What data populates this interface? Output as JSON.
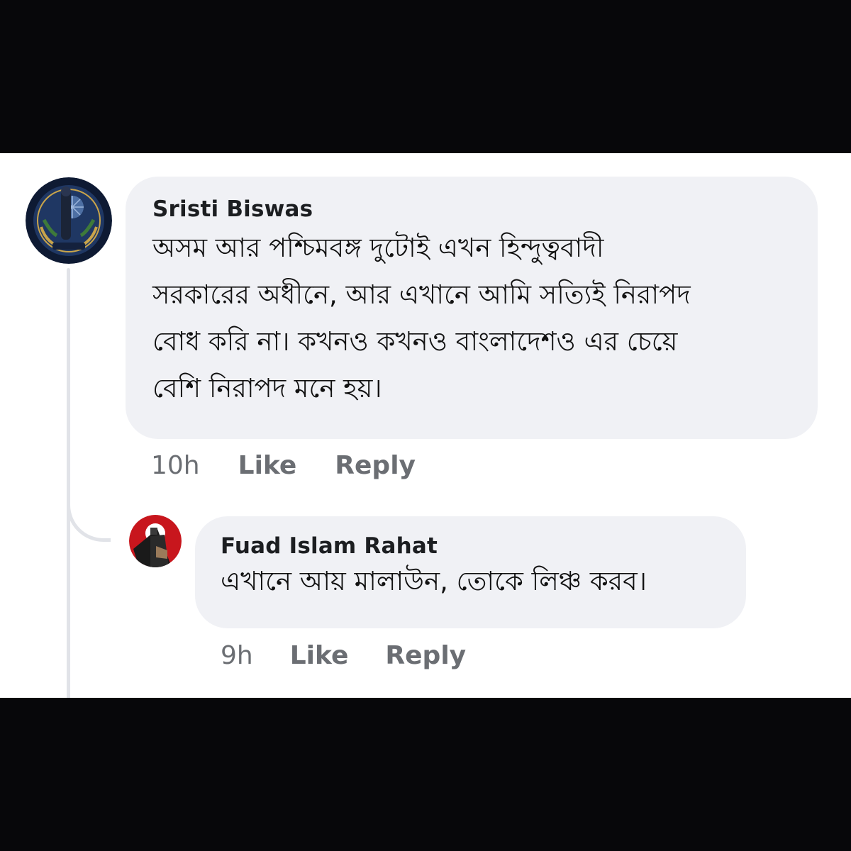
{
  "comments": [
    {
      "author": "Sristi Biswas",
      "text": "অসম আর পশ্চিমবঙ্গ দুটোই এখন হিন্দুত্ববাদী\nসরকারের অধীনে, আর এখানে আমি সত্যিই নিরাপদ\nবোধ করি না। কখনও কখনও বাংলাদেশও এর চেয়ে\nবেশি নিরাপদ মনে হয়।",
      "time": "10h",
      "like_label": "Like",
      "reply_label": "Reply",
      "avatar_icon": "emblem-avatar-icon"
    },
    {
      "author": "Fuad Islam Rahat",
      "text": "এখানে আয় মালাউন, তোকে লিঞ্চ করব।",
      "time": "9h",
      "like_label": "Like",
      "reply_label": "Reply",
      "avatar_icon": "red-figure-avatar-icon"
    }
  ],
  "colors": {
    "bubble_bg": "#f0f1f5",
    "meta_text": "#6b6e73",
    "thread_line": "#e1e3e8",
    "letterbox": "#07070a"
  }
}
